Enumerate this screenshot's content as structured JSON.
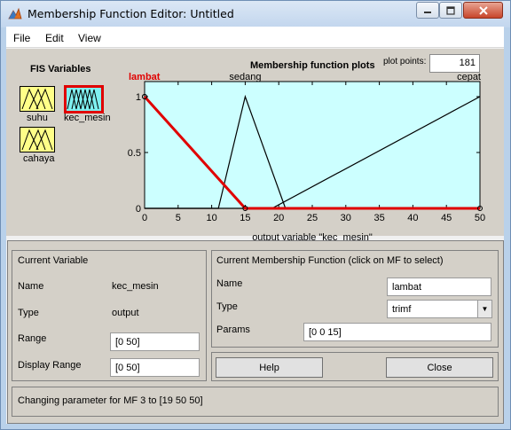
{
  "window": {
    "title": "Membership Function Editor: Untitled"
  },
  "menu": {
    "file": "File",
    "edit": "Edit",
    "view": "View"
  },
  "fis": {
    "title": "FIS Variables",
    "variables": [
      {
        "name": "suhu",
        "kind": "input",
        "active": false
      },
      {
        "name": "kec_mesin",
        "kind": "output",
        "active": true
      },
      {
        "name": "cahaya",
        "kind": "input",
        "active": false
      }
    ]
  },
  "plot": {
    "title": "Membership function plots",
    "points_label": "plot points:",
    "points_value": "181"
  },
  "chart_data": {
    "type": "line",
    "title": "Membership function plots",
    "xlabel": "output variable \"kec_mesin\"",
    "ylabel": "",
    "xlim": [
      0,
      50
    ],
    "ylim": [
      0,
      1
    ],
    "xticks": [
      "0",
      "5",
      "10",
      "15",
      "20",
      "25",
      "30",
      "35",
      "40",
      "45",
      "50"
    ],
    "yticks": [
      "0",
      "0.5",
      "1"
    ],
    "background": "#ccffff",
    "series": [
      {
        "name": "lambat",
        "color": "#e00000",
        "selected": true,
        "x": [
          0,
          0,
          15,
          50
        ],
        "y": [
          1,
          1,
          0,
          0
        ]
      },
      {
        "name": "sedang",
        "color": "#000000",
        "selected": false,
        "x": [
          0,
          11,
          15,
          21,
          50
        ],
        "y": [
          0,
          0,
          1,
          0,
          0
        ]
      },
      {
        "name": "cepat",
        "color": "#000000",
        "selected": false,
        "x": [
          0,
          19,
          50
        ],
        "y": [
          0,
          0,
          1
        ]
      }
    ]
  },
  "current_variable": {
    "header": "Current Variable",
    "name_label": "Name",
    "name_value": "kec_mesin",
    "type_label": "Type",
    "type_value": "output",
    "range_label": "Range",
    "range_value": "[0 50]",
    "display_range_label": "Display Range",
    "display_range_value": "[0 50]"
  },
  "current_mf": {
    "header": "Current Membership Function (click on MF to select)",
    "name_label": "Name",
    "name_value": "lambat",
    "type_label": "Type",
    "type_value": "trimf",
    "params_label": "Params",
    "params_value": "[0 0 15]"
  },
  "buttons": {
    "help": "Help",
    "close": "Close"
  },
  "status": {
    "text": "Changing parameter for MF 3 to  [19 50 50]"
  }
}
